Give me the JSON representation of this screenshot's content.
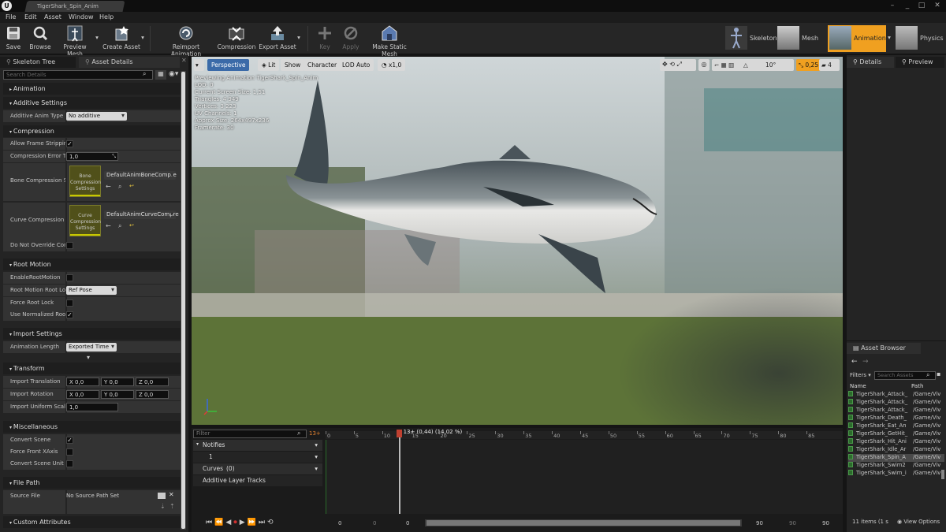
{
  "window": {
    "tab": "TigerShark_Spin_Anim"
  },
  "menu": [
    "File",
    "Edit",
    "Asset",
    "Window",
    "Help"
  ],
  "toolbar": {
    "save": "Save",
    "browse": "Browse",
    "preview_mesh": "Preview Mesh",
    "create_asset": "Create Asset",
    "reimport": "Reimport Animation",
    "compression": "Compression",
    "export": "Export Asset",
    "key": "Key",
    "apply": "Apply",
    "make_static": "Make Static Mesh"
  },
  "modes": {
    "skeleton": "Skeleton",
    "mesh": "Mesh",
    "animation": "Animation",
    "physics": "Physics",
    "accent": "#f0a020"
  },
  "left": {
    "tabs": [
      "Skeleton Tree",
      "Asset Details"
    ],
    "search_placeholder": "Search Details",
    "cat_animation": "Animation",
    "cat_additive": "Additive Settings",
    "additive_type_label": "Additive Anim Type",
    "additive_type_value": "No additive",
    "cat_compression": "Compression",
    "allow_frame_label": "Allow Frame Stripping",
    "comp_error_label": "Compression Error Th",
    "comp_error_value": "1,0",
    "bone_comp_label": "Bone Compression Se",
    "bone_thumb": "Bone Compression Settings",
    "bone_value": "DefaultAnimBoneCompre",
    "curve_comp_label": "Curve Compression S",
    "curve_thumb": "Curve Compression Settings",
    "curve_value": "DefaultAnimCurveCompre",
    "do_not_override_label": "Do Not Override Comp",
    "cat_root": "Root Motion",
    "enable_root_label": "EnableRootMotion",
    "root_lock_label": "Root Motion Root Loc",
    "root_lock_value": "Ref Pose",
    "force_root_label": "Force Root Lock",
    "use_norm_label": "Use Normalized Root",
    "cat_import": "Import Settings",
    "anim_length_label": "Animation Length",
    "anim_length_value": "Exported Time",
    "cat_transform": "Transform",
    "import_translation_label": "Import Translation",
    "import_rotation_label": "Import Rotation",
    "xyz": {
      "x": "X",
      "y": "Y",
      "z": "Z",
      "v": "0,0"
    },
    "uniform_scale_label": "Import Uniform Scale",
    "uniform_scale_value": "1,0",
    "cat_misc": "Miscellaneous",
    "convert_scene_label": "Convert Scene",
    "force_front_label": "Force Front XAxis",
    "convert_unit_label": "Convert Scene Unit",
    "cat_filepath": "File Path",
    "source_file_label": "Source File",
    "source_file_value": "No Source Path Set",
    "cat_custom": "Custom Attributes"
  },
  "viewport": {
    "perspective": "Perspective",
    "lit": "Lit",
    "show": "Show",
    "character": "Character",
    "lod": "LOD Auto",
    "speed": "x1,0",
    "snap_angle": "10°",
    "snap_scale": "0,25",
    "cam_speed": "4",
    "info": [
      "Previewing Animation TigerShark_Spin_Anim",
      "LOD: 0",
      "Current Screen Size: 1,51",
      "Triangles: 4 949",
      "Vertices: 3 223",
      "UV Channels: 1",
      "Approx Size: 264x497x236",
      "Framerate: 30"
    ]
  },
  "timeline": {
    "filter_placeholder": "Filter",
    "frame_badge": "13+",
    "notifies": "Notifies",
    "notify_track": "1",
    "curves": "Curves",
    "curves_count": "(0)",
    "additive": "Additive Layer Tracks",
    "scrub_label": "13+ (0,44) (14,02 %)",
    "ticks": [
      "0",
      "5",
      "10",
      "15",
      "20",
      "25",
      "30",
      "35",
      "40",
      "45",
      "50",
      "55",
      "60",
      "65",
      "70",
      "75",
      "80",
      "85"
    ],
    "range_left": [
      "0",
      "0",
      "0"
    ],
    "range_right": [
      "90",
      "90",
      "90"
    ],
    "playhead_fraction": 0.1402
  },
  "details": {
    "tab1": "Details",
    "tab2": "Preview"
  },
  "browser": {
    "tab": "Asset Browser",
    "filters": "Filters",
    "search_placeholder": "Search Assets",
    "col_name": "Name",
    "col_path": "Path",
    "items": [
      {
        "name": "TigerShark_Attack_",
        "path": "/Game/Viv"
      },
      {
        "name": "TigerShark_Attack_",
        "path": "/Game/Viv"
      },
      {
        "name": "TigerShark_Attack_",
        "path": "/Game/Viv"
      },
      {
        "name": "TigerShark_Death_",
        "path": "/Game/Viv"
      },
      {
        "name": "TigerShark_Eat_An",
        "path": "/Game/Viv"
      },
      {
        "name": "TigerShark_GetHit_",
        "path": "/Game/Viv"
      },
      {
        "name": "TigerShark_Hit_Ani",
        "path": "/Game/Viv"
      },
      {
        "name": "TigerShark_Idle_Ar",
        "path": "/Game/Viv"
      },
      {
        "name": "TigerShark_Spin_A",
        "path": "/Game/Viv"
      },
      {
        "name": "TigerShark_Swim2",
        "path": "/Game/Viv"
      },
      {
        "name": "TigerShark_Swim_i",
        "path": "/Game/Viv"
      }
    ],
    "count": "11 items (1 s",
    "view_options": "View Options"
  }
}
